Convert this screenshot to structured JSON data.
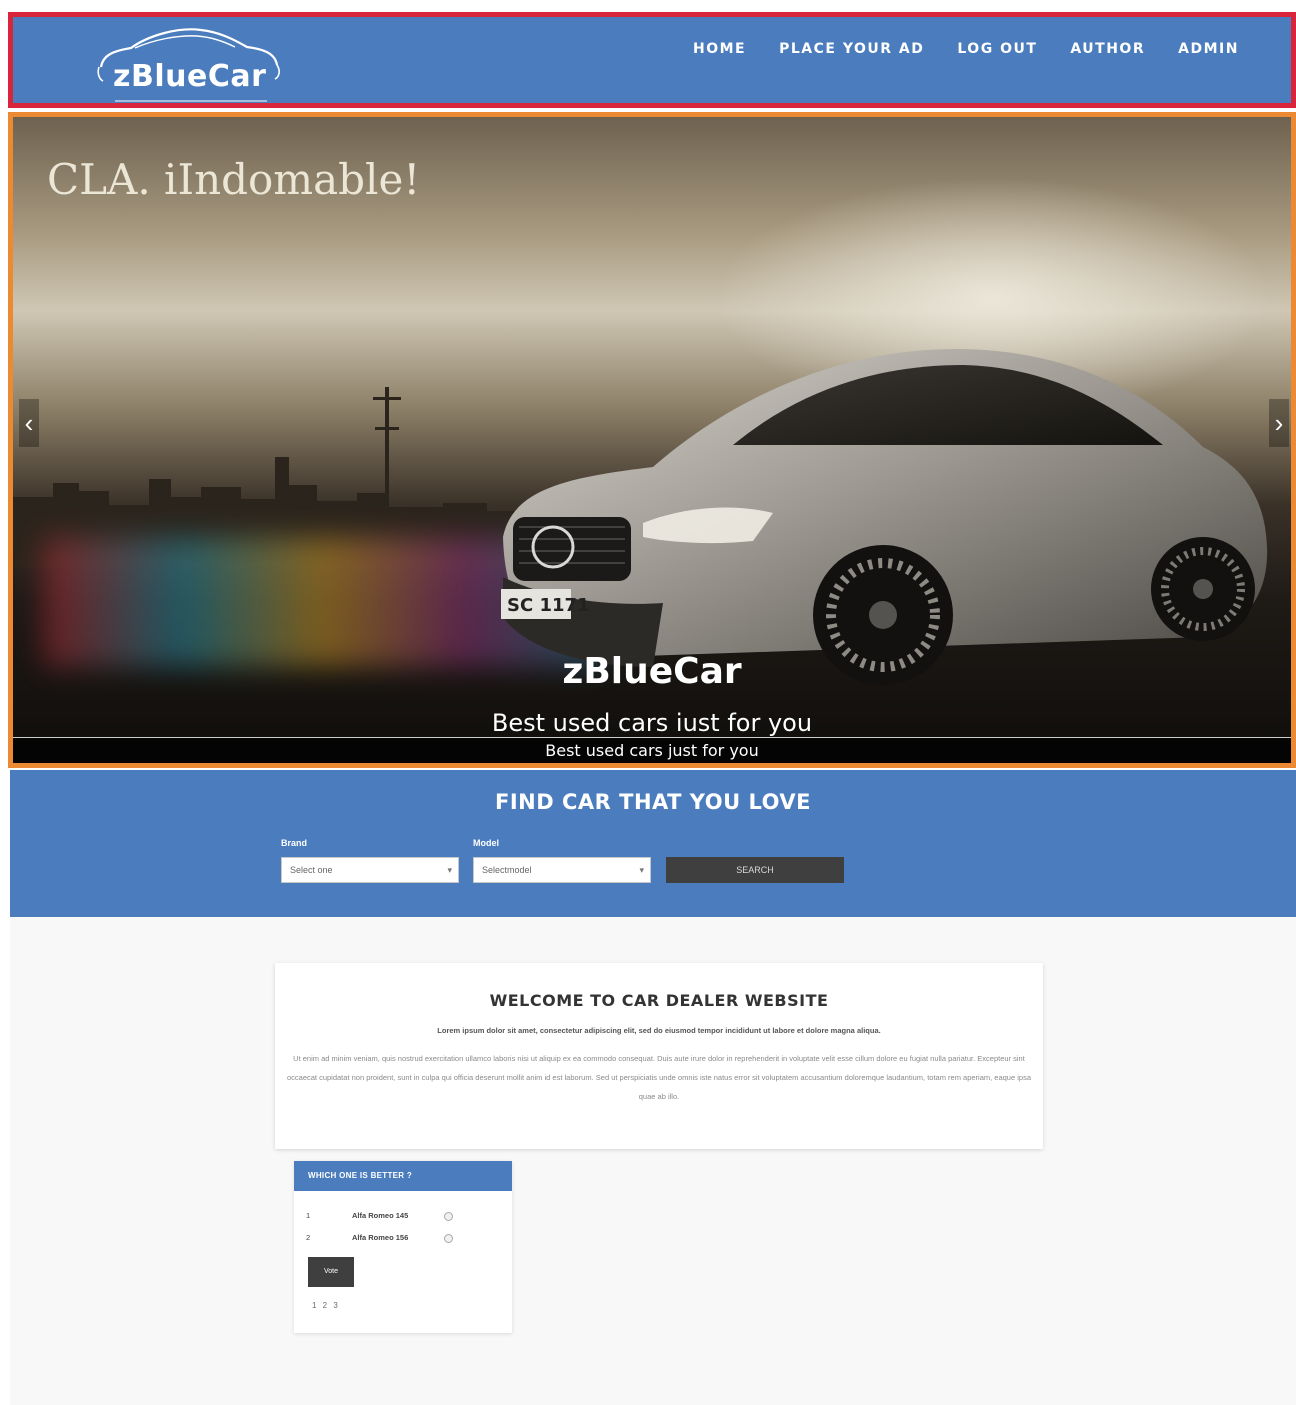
{
  "header": {
    "brand": "zBlueCar",
    "nav": [
      "HOME",
      "PLACE YOUR AD",
      "LOG OUT",
      "AUTHOR",
      "ADMIN"
    ]
  },
  "hero": {
    "headline": "CLA. iIndomable!",
    "plate": "SC 1171",
    "caption_title": "zBlueCar",
    "caption_subtitle": "Best used cars iust for you",
    "caption_bar": "Best used cars just for you"
  },
  "search": {
    "title": "FIND CAR THAT YOU LOVE",
    "brand_label": "Brand",
    "brand_value": "Select one",
    "model_label": "Model",
    "model_value": "Selectmodel",
    "search_button": "SEARCH"
  },
  "welcome": {
    "title": "WELCOME TO CAR DEALER WEBSITE",
    "lead": "Lorem ipsum dolor sit amet, consectetur adipiscing elit, sed do eiusmod tempor incididunt ut labore et dolore magna aliqua.",
    "body": "Ut enim ad minim veniam, quis nostrud exercitation ullamco laboris nisi ut aliquip ex ea commodo consequat. Duis aute irure dolor in reprehenderit in voluptate velit esse cillum dolore eu fugiat nulla pariatur. Excepteur sint occaecat cupidatat non proident, sunt in culpa qui officia deserunt mollit anim id est laborum. Sed ut perspiciatis unde omnis iste natus error sit voluptatem accusantium doloremque laudantium, totam rem aperiam, eaque ipsa quae ab illo."
  },
  "poll": {
    "title": "WHICH ONE IS BETTER ?",
    "options": [
      {
        "num": "1",
        "label": "Alfa Romeo 145"
      },
      {
        "num": "2",
        "label": "Alfa Romeo 156"
      }
    ],
    "vote_button": "Vote",
    "pager": "1 2 3"
  },
  "colors": {
    "header_blue": "#4b7dbe",
    "dark_button": "#3f3f3f",
    "header_outline": "#d8253c",
    "hero_outline": "#ec8a33"
  },
  "icons": [
    "car-outline-logo-icon",
    "chevron-left-icon",
    "chevron-right-icon",
    "caret-down-icon"
  ]
}
